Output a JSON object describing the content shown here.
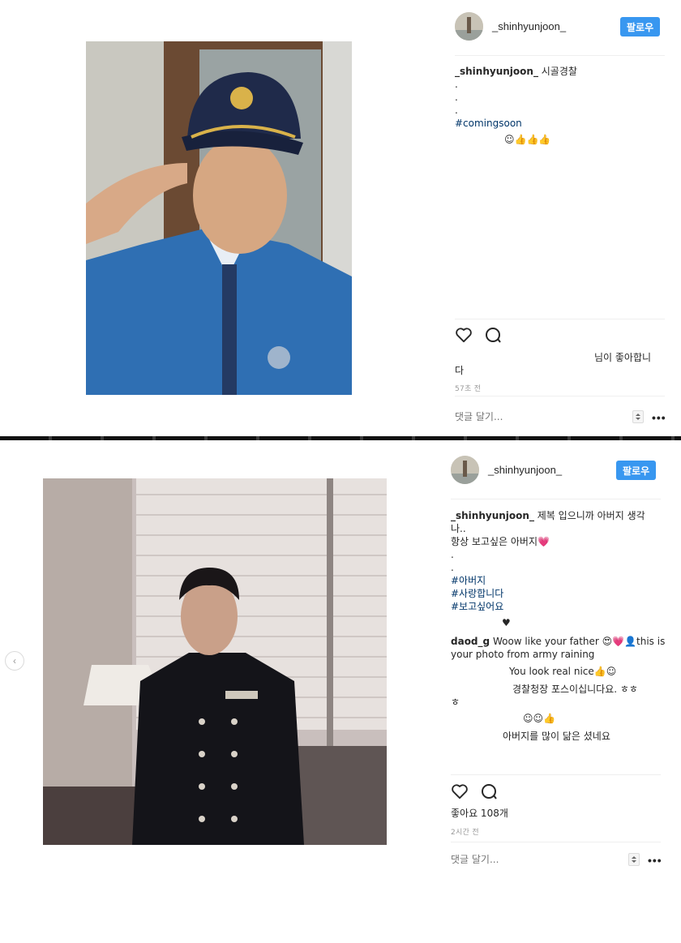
{
  "post1": {
    "username": "_shinhyunjoon_",
    "follow_label": "팔로우",
    "caption": {
      "user": "_shinhyunjoon_",
      "text": "시골경찰",
      "dot1": ".",
      "dot2": ".",
      "dot3": ".",
      "hashtag": "#comingsoon",
      "emoji_line": "☺👍👍👍"
    },
    "likes_line1": "님이 좋아합니",
    "likes_line2": "다",
    "timestamp": "57초 전",
    "comment_placeholder": "댓글 달기...",
    "more": "•••"
  },
  "post2": {
    "username": "_shinhyunjoon_",
    "follow_label": "팔로우",
    "caption": {
      "user": "_shinhyunjoon_",
      "text_line1": "제복 입으니까 아버지 생각",
      "text_line2": "나..",
      "line3": "항상 보고싶은 아버지💗",
      "dot1": ".",
      "dot2": ".",
      "tag1": "#아버지",
      "tag2": "#사랑합니다",
      "tag3": "#보고싶어요",
      "heart": "♥"
    },
    "comments": [
      {
        "user": "daod_g",
        "text": "Woow like your father 😍💗👤this is",
        "text2": "your photo from army raining"
      },
      {
        "user": "",
        "text": "You look real nice👍☺"
      },
      {
        "user": "",
        "text": "경찰청장 포스이십니다요. ㅎㅎ",
        "text2": "ㅎ"
      },
      {
        "user": "",
        "text": "☺☺👍"
      },
      {
        "user": "",
        "text": "아버지를 많이 닮은 셨네요"
      }
    ],
    "likes": "좋아요 108개",
    "timestamp": "2시간 전",
    "comment_placeholder": "댓글 달기...",
    "more": "•••",
    "prev_arrow": "‹"
  },
  "colors": {
    "accent": "#3897f0",
    "hashtag": "#003569",
    "muted": "#999999",
    "border": "#efefef"
  },
  "icons": [
    "heart-icon",
    "comment-icon",
    "chevron-left-icon",
    "more-icon",
    "stepper-icon"
  ]
}
